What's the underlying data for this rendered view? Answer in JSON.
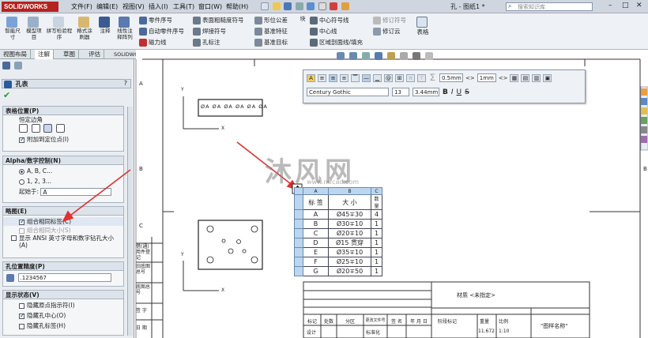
{
  "app": {
    "logo": "SOLIDWORKS",
    "doc_title": "孔 - 图纸1 *",
    "search_placeholder": "搜索知识库"
  },
  "menu": [
    "文件(F)",
    "编辑(E)",
    "视图(V)",
    "插入(I)",
    "工具(T)",
    "窗口(W)",
    "帮助(H)"
  ],
  "ribbon": {
    "big": [
      "智能尺寸",
      "模型项目",
      "拼写检验程序",
      "格式涂刷器",
      "注释",
      "线性注释阵列"
    ],
    "col1": [
      "零件序号",
      "自动零件序号",
      "磁力线"
    ],
    "col2": [
      "表面粗糙度符号",
      "焊接符号",
      "孔标注"
    ],
    "col3": [
      "形位公差",
      "基准特征",
      "基准目标"
    ],
    "col4": [
      "中心符号线",
      "中心线",
      "区域剖面线/填充"
    ],
    "col5": [
      "修订符号",
      "修订云"
    ],
    "tables": "表格"
  },
  "tabs": [
    "视图布局",
    "注解",
    "草图",
    "评估",
    "SOLIDWORKS 插件"
  ],
  "panel": {
    "title": "孔表",
    "help": "?",
    "s1": {
      "header": "表格位置(P)",
      "label": "恒定边角",
      "attach": "附加到定位点(I)"
    },
    "s2": {
      "header": "Alpha/数字控制(N)",
      "opt1": "A, B, C...",
      "opt2": "1, 2, 3...",
      "start_label": "起始于:",
      "start_value": "A"
    },
    "s3": {
      "header": "略图(E)",
      "combine_same_tag": "组合相同标签(C)",
      "combine_same_size": "组合相同大小(S)",
      "ansi": "显示 ANSI 英寸字母和数字钻孔大小(A)"
    },
    "s4": {
      "header": "孔位置精度(P)",
      "value": ".1234567"
    },
    "s5": {
      "header": "显示状态(V)",
      "h1": "隐藏原点指示符(I)",
      "h2": "隐藏孔中心(O)",
      "h3": "隐藏孔标签(H)"
    }
  },
  "format": {
    "font": "Century Gothic",
    "size": "13",
    "height": "3.44mm",
    "line": "0.5mm",
    "line2": "1mm",
    "bold": "B",
    "italic": "I",
    "underline": "U",
    "strike": "S",
    "sigma": "∑",
    "zoom_icons": "view-toolbar"
  },
  "hole_table": {
    "col_letters": [
      "A",
      "B",
      "C"
    ],
    "headers": [
      "标 签",
      "大 小",
      "数量"
    ],
    "rows": [
      [
        "A",
        "Ø45∓30",
        "4"
      ],
      [
        "B",
        "Ø30∓10",
        "1"
      ],
      [
        "C",
        "Ø20∓10",
        "1"
      ],
      [
        "D",
        "Ø15 贯穿",
        "1"
      ],
      [
        "E",
        "Ø35∓10",
        "1"
      ],
      [
        "F",
        "Ø25∓10",
        "1"
      ],
      [
        "G",
        "Ø20∓50",
        "1"
      ]
    ]
  },
  "hole_tags_top": [
    "ØA",
    "ØA",
    "ØA",
    "ØA",
    "ØA",
    "ØA"
  ],
  "title_block": {
    "material": "材质 <未指定>",
    "drawing_name": "\"图样名称\"",
    "headers": [
      "标记",
      "处数",
      "分区",
      "更改文件号",
      "签 名",
      "年 月 日"
    ],
    "right_headers": [
      "阶段标记",
      "重量",
      "比例"
    ],
    "design": "设计",
    "std": "标准化",
    "weight": "11.672",
    "scale": "1:10"
  },
  "left_col_labels": [
    "借(通)用件登记",
    "旧底图总号",
    "底图总号",
    "签 字",
    "日 期"
  ],
  "zone_letters": [
    "A",
    "B",
    "C"
  ],
  "watermark": {
    "text": "沐风网",
    "url": "www.mfcad.com"
  },
  "axis": {
    "y": "Y",
    "x": "X"
  },
  "colors": {
    "brand": "#b3231f",
    "table_hdr": "#bcd6ef",
    "accent": "#2060a0"
  }
}
